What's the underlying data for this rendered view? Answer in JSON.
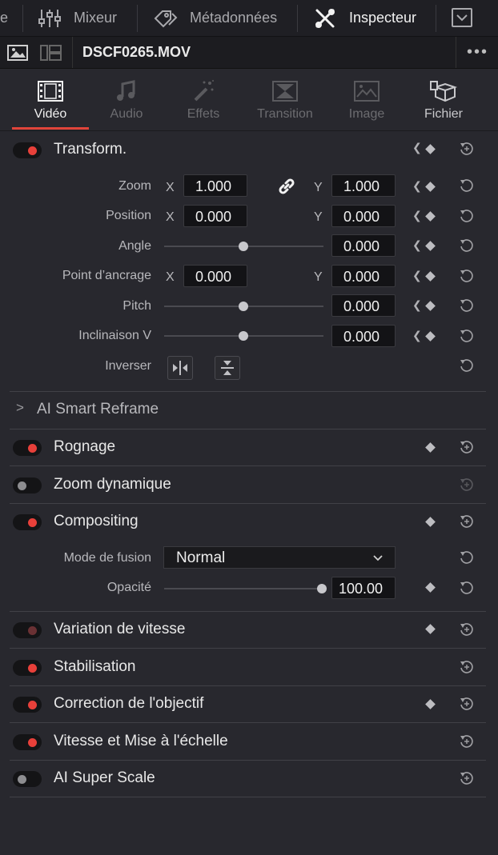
{
  "topbar": {
    "partial_left": "e",
    "mixer_label": "Mixeur",
    "metadata_label": "Métadonnées",
    "inspector_label": "Inspecteur"
  },
  "file": {
    "name": "DSCF0265.MOV",
    "more": "•••"
  },
  "tabs": [
    {
      "label": "Vidéo",
      "icon": "film-icon",
      "state": "active"
    },
    {
      "label": "Audio",
      "icon": "music-note-icon",
      "state": "disabled"
    },
    {
      "label": "Effets",
      "icon": "magic-wand-icon",
      "state": "disabled"
    },
    {
      "label": "Transition",
      "icon": "transition-icon",
      "state": "disabled"
    },
    {
      "label": "Image",
      "icon": "image-icon",
      "state": "disabled"
    },
    {
      "label": "Fichier",
      "icon": "file-box-icon",
      "state": "enabled"
    }
  ],
  "transform": {
    "title": "Transform.",
    "zoom": {
      "label": "Zoom",
      "x_axis": "X",
      "y_axis": "Y",
      "x": "1.000",
      "y": "1.000"
    },
    "position": {
      "label": "Position",
      "x_axis": "X",
      "y_axis": "Y",
      "x": "0.000",
      "y": "0.000"
    },
    "angle": {
      "label": "Angle",
      "value": "0.000",
      "slider": 0.5
    },
    "anchor": {
      "label": "Point d’ancrage",
      "x_axis": "X",
      "y_axis": "Y",
      "x": "0.000",
      "y": "0.000"
    },
    "pitch": {
      "label": "Pitch",
      "value": "0.000",
      "slider": 0.5
    },
    "tilt": {
      "label": "Inclinaison V",
      "value": "0.000",
      "slider": 0.5
    },
    "flip": {
      "label": "Inverser"
    }
  },
  "ai_reframe": {
    "label": "AI Smart Reframe",
    "chevron": ">"
  },
  "sections": {
    "crop": "Rognage",
    "dynamic_zoom": "Zoom dynamique",
    "compositing": "Compositing",
    "speed_change": "Variation de vitesse",
    "stabilization": "Stabilisation",
    "lens_correction": "Correction de l'objectif",
    "retime_scaling": "Vitesse et Mise à l'échelle",
    "super_scale": "AI Super Scale"
  },
  "compositing": {
    "blend_label": "Mode de fusion",
    "blend_value": "Normal",
    "opacity_label": "Opacité",
    "opacity_value": "100.00",
    "opacity_slider": 1.0
  },
  "colors": {
    "accent": "#e0443a",
    "toggle_on": "#e8403a",
    "background": "#28282e"
  }
}
